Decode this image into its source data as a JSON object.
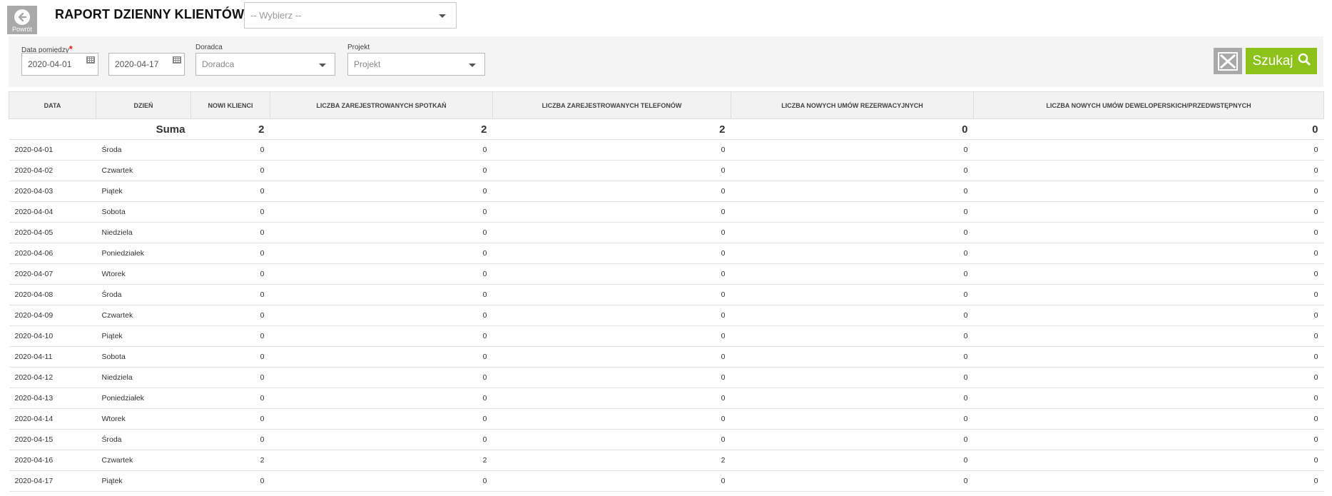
{
  "header": {
    "back_label": "Powrót",
    "title": "RAPORT DZIENNY KLIENTÓW",
    "select_placeholder": "-- Wybierz --"
  },
  "filters": {
    "date_label": "Data pomiędzy",
    "required_mark": "*",
    "date_from": "2020-04-01",
    "date_to": "2020-04-17",
    "advisor_label": "Doradca",
    "advisor_value": "Doradca",
    "project_label": "Projekt",
    "project_value": "Projekt",
    "search_label": "Szukaj"
  },
  "table": {
    "columns": [
      "DATA",
      "DZIEŃ",
      "NOWI KLIENCI",
      "LICZBA ZAREJESTROWANYCH SPOTKAŃ",
      "LICZBA ZAREJESTROWANYCH TELEFONÓW",
      "LICZBA NOWYCH UMÓW REZERWACYJNYCH",
      "LICZBA NOWYCH UMÓW DEWELOPERSKICH/PRZEDWSTĘPNYCH"
    ],
    "sum": {
      "label": "Suma",
      "values": [
        "2",
        "2",
        "2",
        "0",
        "0"
      ]
    },
    "rows": [
      [
        "2020-04-01",
        "Środa",
        "0",
        "0",
        "0",
        "0",
        "0"
      ],
      [
        "2020-04-02",
        "Czwartek",
        "0",
        "0",
        "0",
        "0",
        "0"
      ],
      [
        "2020-04-03",
        "Piątek",
        "0",
        "0",
        "0",
        "0",
        "0"
      ],
      [
        "2020-04-04",
        "Sobota",
        "0",
        "0",
        "0",
        "0",
        "0"
      ],
      [
        "2020-04-05",
        "Niedziela",
        "0",
        "0",
        "0",
        "0",
        "0"
      ],
      [
        "2020-04-06",
        "Poniedziałek",
        "0",
        "0",
        "0",
        "0",
        "0"
      ],
      [
        "2020-04-07",
        "Wtorek",
        "0",
        "0",
        "0",
        "0",
        "0"
      ],
      [
        "2020-04-08",
        "Środa",
        "0",
        "0",
        "0",
        "0",
        "0"
      ],
      [
        "2020-04-09",
        "Czwartek",
        "0",
        "0",
        "0",
        "0",
        "0"
      ],
      [
        "2020-04-10",
        "Piątek",
        "0",
        "0",
        "0",
        "0",
        "0"
      ],
      [
        "2020-04-11",
        "Sobota",
        "0",
        "0",
        "0",
        "0",
        "0"
      ],
      [
        "2020-04-12",
        "Niedziela",
        "0",
        "0",
        "0",
        "0",
        "0"
      ],
      [
        "2020-04-13",
        "Poniedziałek",
        "0",
        "0",
        "0",
        "0",
        "0"
      ],
      [
        "2020-04-14",
        "Wtorek",
        "0",
        "0",
        "0",
        "0",
        "0"
      ],
      [
        "2020-04-15",
        "Środa",
        "0",
        "0",
        "0",
        "0",
        "0"
      ],
      [
        "2020-04-16",
        "Czwartek",
        "2",
        "2",
        "2",
        "0",
        "0"
      ],
      [
        "2020-04-17",
        "Piątek",
        "0",
        "0",
        "0",
        "0",
        "0"
      ]
    ]
  },
  "colors": {
    "search_button": "#8cc21a",
    "gray_button": "#a9a9a9",
    "required": "#e02020"
  },
  "icons": {
    "back": "arrow-left-circle-icon",
    "calendar": "calendar-icon",
    "clear": "clear-filter-icon",
    "search": "search-icon"
  }
}
